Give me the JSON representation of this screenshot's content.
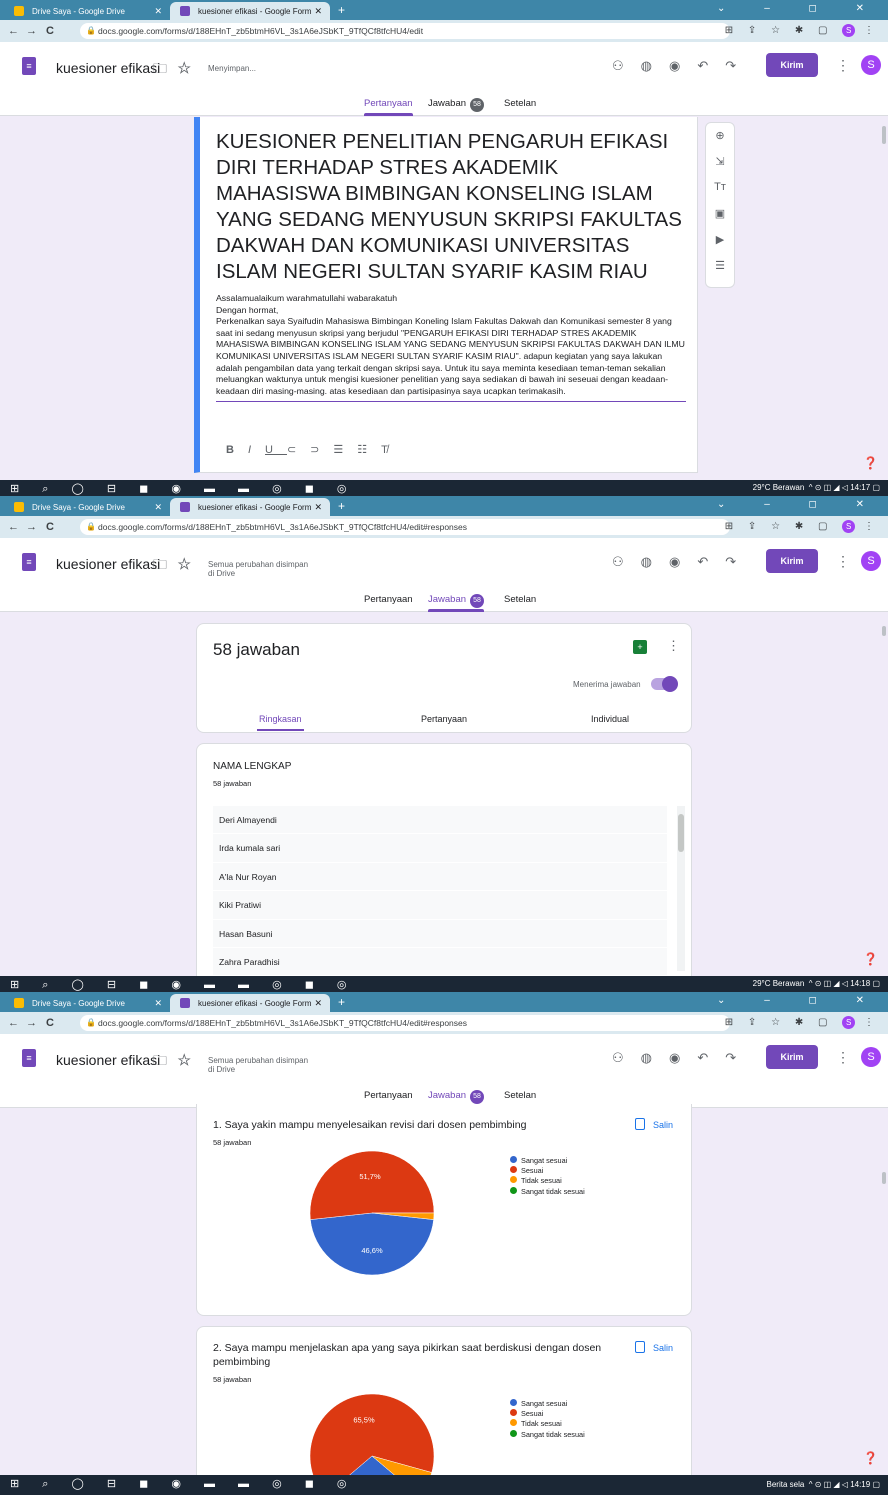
{
  "browser": {
    "tabs": [
      "Drive Saya - Google Drive",
      "kuesioner efikasi - Google Form"
    ],
    "url_edit": "docs.google.com/forms/d/188EHnT_zb5btmH6VL_3s1A6eJSbKT_9TfQCf8tfcHU4/edit",
    "url_responses": "docs.google.com/forms/d/188EHnT_zb5btmH6VL_3s1A6eJSbKT_9TfQCf8tfcHU4/edit#responses"
  },
  "form": {
    "title": "kuesioner efikasi",
    "status_saving": "Menyimpan...",
    "status_saved_line1": "Semua perubahan disimpan",
    "status_saved_line2": "di Drive",
    "send_label": "Kirim",
    "avatar_letter": "S",
    "tabs": {
      "questions": "Pertanyaan",
      "responses": "Jawaban",
      "settings": "Setelan",
      "count": "58"
    }
  },
  "screen1": {
    "heading": "KUESIONER PENELITIAN PENGARUH EFIKASI DIRI TERHADAP STRES AKADEMIK MAHASISWA BIMBINGAN KONSELING ISLAM YANG SEDANG MENYUSUN SKRIPSI FAKULTAS DAKWAH DAN KOMUNIKASI UNIVERSITAS ISLAM NEGERI SULTAN SYARIF KASIM RIAU",
    "greeting": "Assalamualaikum warahmatullahi wabarakatuh",
    "salutation": "Dengan hormat,",
    "body": "Perkenalkan saya Syaifudin Mahasiswa Bimbingan Koneling Islam Fakultas Dakwah dan Komunikasi semester 8 yang saat ini sedang menyusun skripsi yang berjudul \"PENGARUH EFIKASI DIRI TERHADAP STRES AKADEMIK MAHASISWA BIMBINGAN KONSELING ISLAM YANG SEDANG MENYUSUN SKRIPSI FAKULTAS DAKWAH DAN ILMU KOMUNIKASI UNIVERSITAS ISLAM NEGERI SULTAN SYARIF KASIM RIAU\". adapun kegiatan yang saya lakukan adalah pengambilan data yang terkait dengan  skripsi saya. Untuk itu saya meminta kesediaan teman-teman sekalian meluangkan waktunya untuk mengisi kuesioner penelitian yang saya sediakan di bawah ini seseuai dengan keadaan-keadaan diri masing-masing. atas kesediaan dan partisipasinya saya ucapkan terimakasih.",
    "taskbar_weather": "29°C Berawan",
    "taskbar_time": "14:17"
  },
  "screen2": {
    "response_count": "58 jawaban",
    "accepting_label": "Menerima jawaban",
    "subtabs": [
      "Ringkasan",
      "Pertanyaan",
      "Individual"
    ],
    "question_label": "NAMA LENGKAP",
    "question_sub": "58 jawaban",
    "names": [
      "Deri Almayendi",
      "Irda kumala sari",
      "A'la Nur Royan",
      "Kiki Pratiwi",
      "Hasan Basuni",
      "Zahra Paradhisi"
    ],
    "taskbar_weather": "29°C Berawan",
    "taskbar_time": "14:18"
  },
  "screen3": {
    "copy_label": "Salin",
    "q1_title": "1. Saya yakin mampu menyelesaikan revisi dari dosen pembimbing",
    "q1_sub": "58 jawaban",
    "q2_title": "2. Saya mampu menjelaskan apa yang saya pikirkan saat berdiskusi dengan dosen pembimbing",
    "q2_sub": "58 jawaban",
    "taskbar_news": "Berita sela",
    "taskbar_time": "14:19"
  },
  "chart_data": [
    {
      "type": "pie",
      "categories": [
        "Sangat sesuai",
        "Sesuai",
        "Tidak sesuai",
        "Sangat tidak sesuai"
      ],
      "colors": [
        "#3366cc",
        "#dc3912",
        "#ff9900",
        "#109618"
      ],
      "values": [
        46.6,
        51.7,
        1.7,
        0
      ],
      "data_labels": [
        "46,6%",
        "51,7%",
        "",
        ""
      ],
      "legend": "right"
    },
    {
      "type": "pie",
      "categories": [
        "Sangat sesuai",
        "Sesuai",
        "Tidak sesuai",
        "Sangat tidak sesuai"
      ],
      "colors": [
        "#3366cc",
        "#dc3912",
        "#ff9900",
        "#109618"
      ],
      "values": [
        27.6,
        65.5,
        6.9,
        0
      ],
      "data_labels": [
        "",
        "65,5%",
        "",
        ""
      ],
      "legend": "right"
    }
  ]
}
